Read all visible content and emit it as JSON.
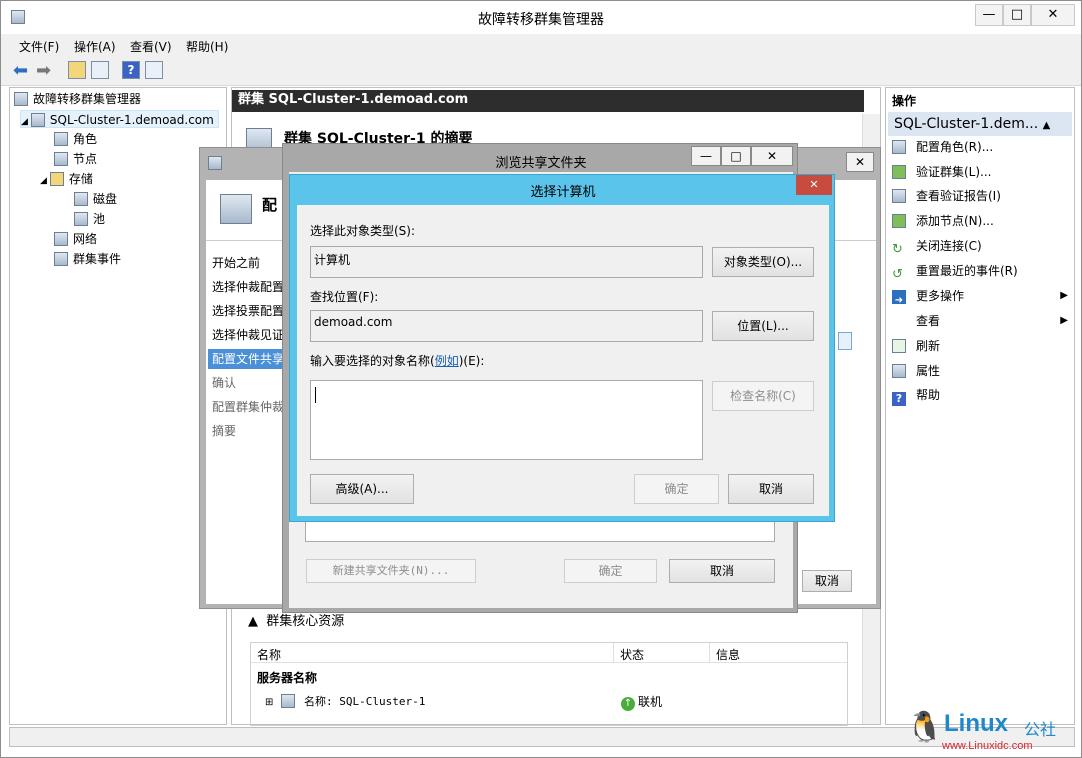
{
  "main_window": {
    "title": "故障转移群集管理器",
    "min": "—",
    "max": "□",
    "close": "✕"
  },
  "menu": [
    "文件(F)",
    "操作(A)",
    "查看(V)",
    "帮助(H)"
  ],
  "tree": {
    "root": "故障转移群集管理器",
    "cluster": "SQL-Cluster-1.demoad.com",
    "roles": "角色",
    "nodes": "节点",
    "storage": "存储",
    "disks": "磁盘",
    "pools": "池",
    "networks": "网络",
    "events": "群集事件"
  },
  "center": {
    "header": "群集 SQL-Cluster-1.demoad.com",
    "summary": "群集 SQL-Cluster-1 的摘要",
    "core_resources": "群集核心资源",
    "columns": [
      "名称",
      "状态",
      "信息"
    ],
    "group": "服务器名称",
    "row_name": "名称: SQL-Cluster-1",
    "row_status": "联机"
  },
  "actions": {
    "header": "操作",
    "cluster": "SQL-Cluster-1.dem...",
    "items": [
      "配置角色(R)...",
      "验证群集(L)...",
      "查看验证报告(I)",
      "添加节点(N)...",
      "关闭连接(C)",
      "重置最近的事件(R)",
      "更多操作",
      "查看",
      "刷新",
      "属性",
      "帮助"
    ]
  },
  "wizard": {
    "title_partial": "配",
    "steps": [
      "开始之前",
      "选择仲裁配置",
      "选择投票配置",
      "选择仲裁见证",
      "配置文件共享",
      "确认",
      "配置群集仲裁",
      "摘要"
    ],
    "cancel": "取消"
  },
  "browse": {
    "title": "浏览共享文件夹",
    "new_share": "新建共享文件夹(N)...",
    "ok": "确定",
    "cancel": "取消",
    "close": "✕"
  },
  "select": {
    "title": "选择计算机",
    "type_label": "选择此对象类型(S):",
    "type_value": "计算机",
    "type_btn": "对象类型(O)...",
    "loc_label": "查找位置(F):",
    "loc_value": "demoad.com",
    "loc_btn": "位置(L)...",
    "name_label_pre": "输入要选择的对象名称(",
    "name_label_link": "例如",
    "name_label_post": ")(E):",
    "check_btn": "检查名称(C)",
    "advanced_btn": "高级(A)...",
    "ok": "确定",
    "cancel": "取消",
    "close": "✕"
  },
  "watermark": {
    "brand": "Linux",
    "suffix": "公社",
    "url": "www.Linuxidc.com"
  }
}
